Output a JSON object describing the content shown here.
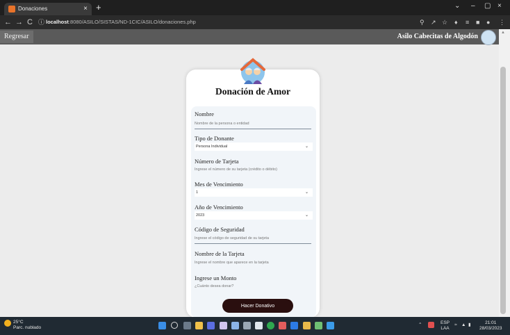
{
  "browser": {
    "tab_title": "Donaciones",
    "tab_close": "×",
    "new_tab": "+",
    "window_controls": [
      "⌄",
      "–",
      "▢",
      "×"
    ],
    "nav": {
      "back": "←",
      "forward": "→",
      "reload": "C",
      "info": "ⓘ"
    },
    "url_host": "localhost",
    "url_path": ":8080/ASILO/SISTAS/ND-1CIC/ASILO/donaciones.php"
  },
  "site": {
    "back_button": "Regresar",
    "title": "Asilo Cabecitas de Algodón"
  },
  "card": {
    "title": "Donación de Amor"
  },
  "form": {
    "nombre": {
      "label": "Nombre",
      "placeholder": "Nombre de la persona o entidad"
    },
    "tipo_donante": {
      "label": "Tipo de Donante",
      "value": "Persona Individual"
    },
    "numero_tarjeta": {
      "label": "Número de Tarjeta",
      "placeholder": "Ingrese el número de su tarjeta (crédito o débito)"
    },
    "mes_vencimiento": {
      "label": "Mes de Vencimiento",
      "value": "1"
    },
    "anio_vencimiento": {
      "label": "Año de Vencimiento",
      "value": "2023"
    },
    "codigo_seguridad": {
      "label": "Código de Seguridad",
      "placeholder": "Ingrese el código de seguridad de su tarjeta"
    },
    "nombre_tarjeta": {
      "label": "Nombre de la Tarjeta",
      "placeholder": "Ingrese el nombre que aparece en la tarjeta"
    },
    "monto": {
      "label": "Ingrese un Monto",
      "placeholder": "¿Cuánto desea donar?"
    },
    "submit": "Hacer Donativo"
  },
  "taskbar": {
    "weather_temp": "25°C",
    "weather_desc": "Parc. nublado",
    "lang": "ESP",
    "lang_sub": "LAA",
    "time": "21:01",
    "date": "28/03/2023"
  },
  "colors": {
    "accent_button": "#2a0f0f",
    "site_bar": "#5a5a5a",
    "form_bg": "#f1f5f9"
  }
}
